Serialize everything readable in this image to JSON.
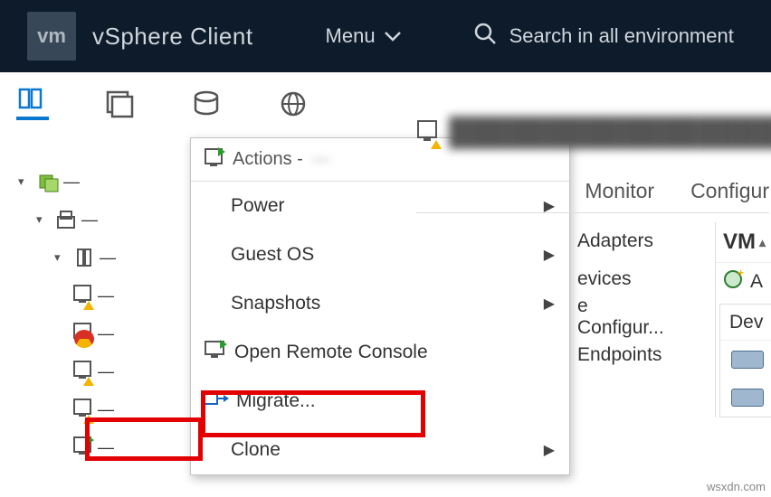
{
  "topbar": {
    "logo_text": "vm",
    "brand": "vSphere Client",
    "menu_label": "Menu",
    "search_placeholder": "Search in all environment"
  },
  "nav_tabs": [
    "hosts",
    "vms",
    "storage",
    "network"
  ],
  "tree": {
    "root": "—",
    "dc": "—",
    "host": "—",
    "vm1": "—",
    "vm2": "—",
    "vm3": "—",
    "vm4": "—",
    "vm5": "—"
  },
  "context_menu": {
    "header_prefix": "Actions -",
    "header_target": "—",
    "items": {
      "power": "Power",
      "guest_os": "Guest OS",
      "snapshots": "Snapshots",
      "open_console": "Open Remote Console",
      "migrate": "Migrate...",
      "clone": "Clone"
    }
  },
  "right": {
    "title": "——",
    "tabs": {
      "monitor": "Monitor",
      "configure": "Configur"
    },
    "rows": {
      "adapters": "Adapters",
      "devices": "evices",
      "config": "e Configur...",
      "endpoints": "Endpoints"
    },
    "panel_title": "VM",
    "action_label": "A",
    "sub_header": "Dev"
  },
  "watermark": "wsxdn.com"
}
